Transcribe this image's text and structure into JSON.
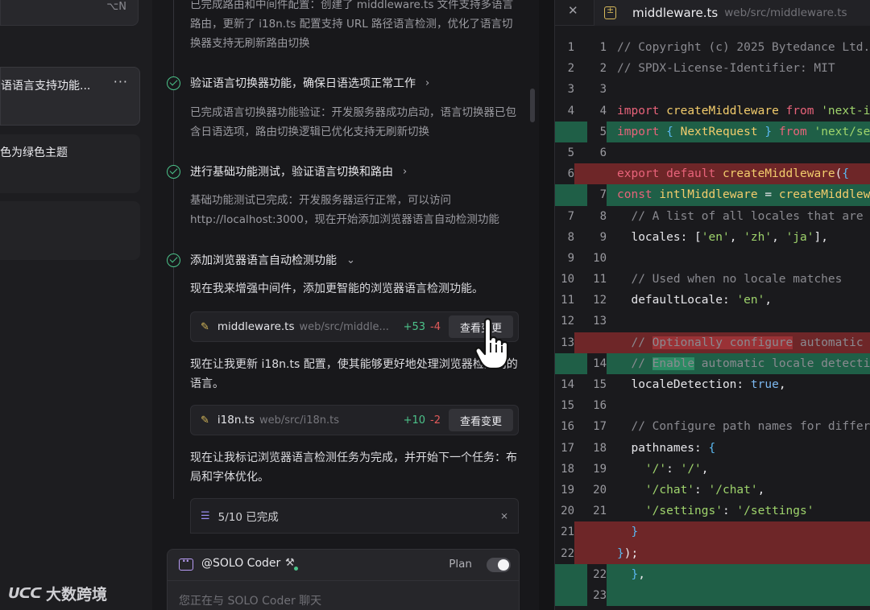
{
  "sidebar": {
    "search_shortcut": "⌥N",
    "items": [
      {
        "title": "语语言支持功能...",
        "more": "···"
      },
      {
        "title": "色为绿色主题"
      },
      {
        "title": ""
      }
    ],
    "logo_mark": "ᑌᑕᑕ",
    "logo_text": "大数跨境"
  },
  "chat": {
    "top_text": "已完成路由和中间件配置：创建了 middleware.ts 文件支持多语言路由，更新了 i18n.ts 配置支持 URL 路径语言检测，优化了语言切换器支持无刷新路由切换",
    "steps": [
      {
        "label": "验证语言切换器功能，确保日语选项正常工作",
        "chevron": "›",
        "text": "已完成语言切换器功能验证：开发服务器成功启动，语言切换器已包含日语选项，路由切换逻辑已优化支持无刷新切换"
      },
      {
        "label": "进行基础功能测试，验证语言切换和路由",
        "chevron": "›",
        "text": "基础功能测试已完成：开发服务器运行正常，可以访问 http://localhost:3000，现在开始添加浏览器语言自动检测功能"
      },
      {
        "label": "添加浏览器语言自动检测功能",
        "chevron": "⌄"
      }
    ],
    "messages": [
      "现在我来增强中间件，添加更智能的浏览器语言检测功能。",
      "现在让我更新 i18n.ts 配置，使其能够更好地处理浏览器检测到的语言。",
      "现在让我标记浏览器语言检测任务为完成，并开始下一个任务：布局和字体优化。"
    ],
    "files": [
      {
        "name": "middleware.ts",
        "path": "web/src/middle...",
        "added": "+53",
        "removed": "-4",
        "action": "查看变更"
      },
      {
        "name": "i18n.ts",
        "path": "web/src/i18n.ts",
        "added": "+10",
        "removed": "-2",
        "action": "查看变更"
      }
    ],
    "todo": {
      "label": "5/10 已完成"
    },
    "composer": {
      "agent": "@SOLO Coder",
      "plan_label": "Plan",
      "placeholder": "您正在与 SOLO Coder 聊天"
    }
  },
  "editor": {
    "tab": {
      "name": "middleware.ts",
      "path": "web/src/middleware.ts"
    },
    "colors": {
      "added_bg": "#1f5f47",
      "removed_bg": "#6e2628"
    }
  }
}
